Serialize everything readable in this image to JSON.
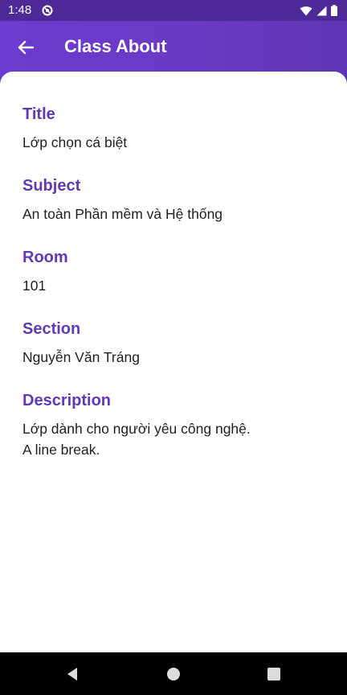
{
  "status_bar": {
    "time": "1:48",
    "icons": [
      "app-notification-icon",
      "wifi-icon",
      "signal-icon",
      "battery-icon"
    ]
  },
  "app_bar": {
    "back_icon": "arrow-back-icon",
    "title": "Class About",
    "color": "#6a3ac4"
  },
  "fields": [
    {
      "label": "Title",
      "value": "Lớp chọn cá biệt"
    },
    {
      "label": "Subject",
      "value": "An toàn Phần mềm và Hệ thống"
    },
    {
      "label": "Room",
      "value": "101"
    },
    {
      "label": "Section",
      "value": "Nguyễn Văn Tráng"
    },
    {
      "label": "Description",
      "value": "Lớp dành cho người yêu công nghệ.\nA line break."
    }
  ],
  "nav_bar": {
    "icons": [
      "back-triangle-icon",
      "home-circle-icon",
      "recents-square-icon"
    ]
  },
  "colors": {
    "accent": "#6239b5",
    "status_bar": "#4d2a98",
    "text": "#1f1f1f"
  }
}
